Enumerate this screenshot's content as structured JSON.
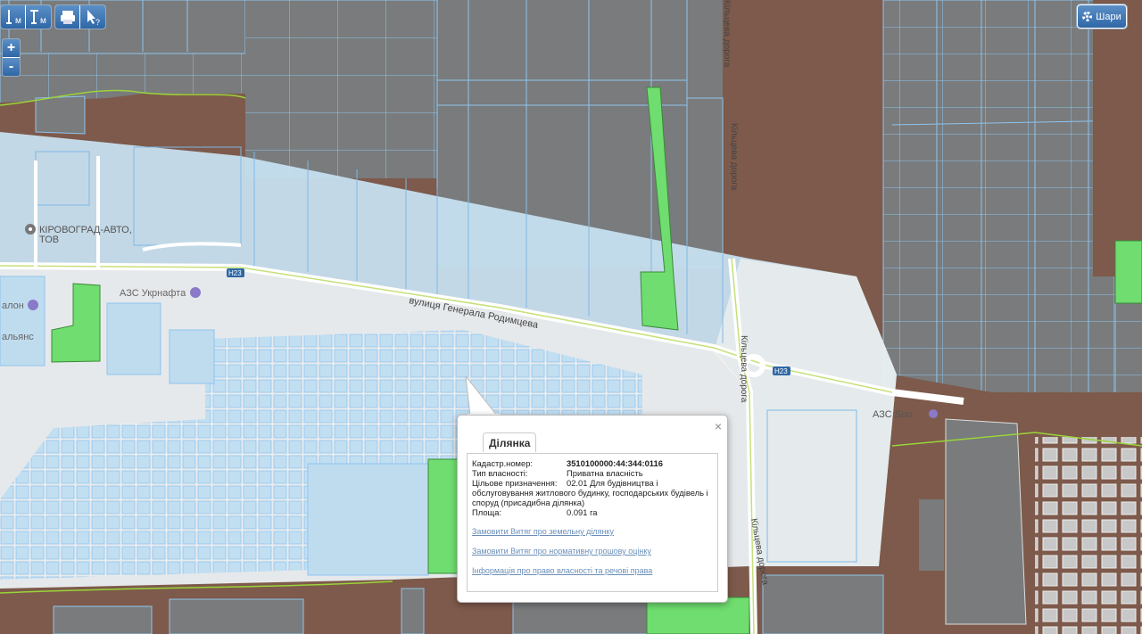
{
  "toolbar": {
    "measure_length_label": "м",
    "measure_area_label": "м",
    "print_icon": "printer-icon",
    "identify_icon": "cursor-question-icon"
  },
  "zoom": {
    "in_label": "+",
    "out_label": "-"
  },
  "layers_button": {
    "label": "Шари",
    "icon": "gear-icon"
  },
  "map_labels": {
    "poi_kirovohrad_line1": "КІРОВОГРАД-АВТО,",
    "poi_kirovohrad_line2": "ТОВ",
    "poi_azs_ukrnafta": "АЗС Укрнафта",
    "poi_salon": "алон",
    "poi_alyans": "альянс",
    "street_rodymtseva": "вулиця Генерала Родимцева",
    "road_kiltseva_1": "Кільцева дорога",
    "road_kiltseva_2": "Кільцева дорога",
    "road_kiltseva_3": "Кільцева дорога",
    "road_kiltseva_4": "Кільцева дорога",
    "shield_h23_a": "H23",
    "shield_h23_b": "H23",
    "poi_azs_sun": "АЗС Sun"
  },
  "popup": {
    "tab_label": "Ділянка",
    "close_label": "×",
    "fields": [
      {
        "label": "Кадастр.номер:",
        "value": "3510100000:44:344:0116"
      },
      {
        "label": "Тип власності:",
        "value": "Приватна власність"
      },
      {
        "label": "Цільове призначення:",
        "value": "02.01 Для будівництва і обслуговування житлового будинку, господарських будівель і споруд (присадибна ділянка)"
      },
      {
        "label": "Площа:",
        "value": "0.091 га"
      }
    ],
    "links": [
      "Замовити Витяг про земельну ділянку",
      "Замовити Витяг про нормативну грошову оцінку",
      "Інформація про право власності та речові права"
    ]
  },
  "colors": {
    "land_brown": "#7d5a4b",
    "parcel_gray": "#797b7c",
    "highlight_blue": "#c9e3f3",
    "parcel_outline": "#7fb8e8",
    "green_parcel": "#6fdd6f",
    "road_white": "#ffffff",
    "boundary_green": "#9ad43a",
    "link_blue": "#6a8fb8",
    "button_blue": "#3b72b0"
  }
}
